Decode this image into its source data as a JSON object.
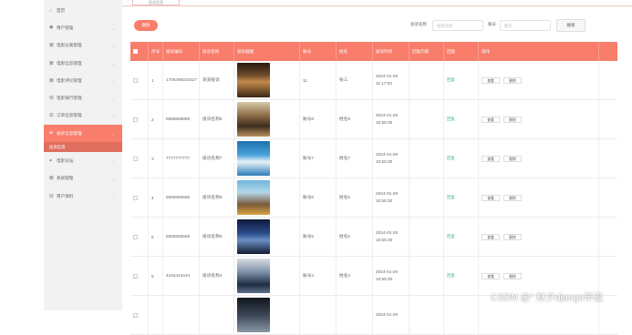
{
  "sidebar": {
    "items": [
      {
        "label": "首页",
        "icon": "home-icon",
        "glyph": "⌂",
        "expandable": false
      },
      {
        "label": "用户管理",
        "icon": "user-icon",
        "glyph": "⚉",
        "expandable": true
      },
      {
        "label": "电影分类管理",
        "icon": "grid-icon",
        "glyph": "▦",
        "expandable": true
      },
      {
        "label": "电影信息管理",
        "icon": "grid-icon",
        "glyph": "▦",
        "expandable": true
      },
      {
        "label": "电影评论管理",
        "icon": "grid-icon",
        "glyph": "▦",
        "expandable": true
      },
      {
        "label": "电影排行管理",
        "icon": "chart-icon",
        "glyph": "▤",
        "expandable": true
      },
      {
        "label": "订单信息管理",
        "icon": "list-icon",
        "glyph": "▥",
        "expandable": true
      },
      {
        "label": "投诉信息管理",
        "icon": "mail-icon",
        "glyph": "✉",
        "expandable": true,
        "active": true
      },
      {
        "label": "电影论坛",
        "icon": "location-icon",
        "glyph": "●",
        "expandable": true
      },
      {
        "label": "系统管理",
        "icon": "grid-icon",
        "glyph": "▦",
        "expandable": true
      },
      {
        "label": "用户资料",
        "icon": "profile-icon",
        "glyph": "▤",
        "expandable": true
      }
    ],
    "active_sub": "投诉信息"
  },
  "tab": {
    "label": "投诉信息"
  },
  "toolbar": {
    "delete_label": "删除",
    "name_label": "投诉名称",
    "name_placeholder": "投诉名称",
    "account_label": "账号",
    "account_placeholder": "账号",
    "search_label": "搜索"
  },
  "table": {
    "headers": [
      "",
      "序号",
      "投诉编号",
      "投诉名称",
      "投诉截图",
      "账号",
      "姓名",
      "投诉时间",
      "回复内容",
      "回复",
      "操作"
    ],
    "rows": [
      {
        "index": "1",
        "code": "1706498223427",
        "name": "某某投诉",
        "account": "11",
        "person": "张三",
        "date": "2024-01-29",
        "time": "11:17:03",
        "reply": "",
        "status": "回复"
      },
      {
        "index": "2",
        "code": "8888888888",
        "name": "投诉名称8",
        "account": "账号8",
        "person": "姓名8",
        "date": "2024-01-29",
        "time": "10:55:30",
        "reply": "",
        "status": "回复"
      },
      {
        "index": "3",
        "code": "7777777777",
        "name": "投诉名称7",
        "account": "账号7",
        "person": "姓名7",
        "date": "2024-01-29",
        "time": "10:55:30",
        "reply": "",
        "status": "回复"
      },
      {
        "index": "4",
        "code": "6666666666",
        "name": "投诉名称6",
        "account": "账号6",
        "person": "姓名6",
        "date": "2024-01-29",
        "time": "10:55:30",
        "reply": "",
        "status": "回复"
      },
      {
        "index": "5",
        "code": "5555555555",
        "name": "投诉名称5",
        "account": "账号5",
        "person": "姓名5",
        "date": "2024-01-29",
        "time": "10:55:30",
        "reply": "",
        "status": "回复"
      },
      {
        "index": "6",
        "code": "4444444444",
        "name": "投诉名称4",
        "account": "账号4",
        "person": "姓名4",
        "date": "2024-01-29",
        "time": "10:55:30",
        "reply": "",
        "status": "回复"
      },
      {
        "index": "",
        "code": "",
        "name": "",
        "account": "",
        "person": "",
        "date": "2024-01-29",
        "time": "",
        "reply": "",
        "status": ""
      }
    ],
    "view_label": "查看",
    "delete_label": "删除"
  },
  "watermark": "CSDN @“ 林夕django毕设",
  "colors": {
    "accent": "#f87d6b",
    "status": "#3bb89a"
  }
}
